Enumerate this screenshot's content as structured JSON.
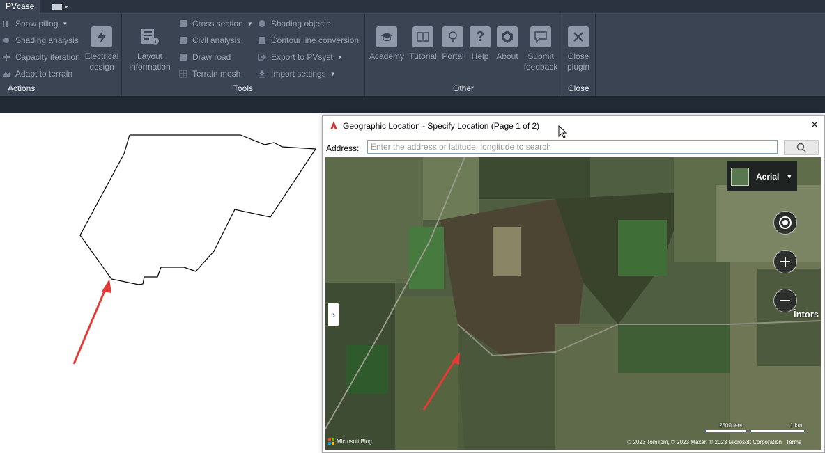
{
  "ribbon": {
    "active_tab": "PVcase",
    "actions": {
      "show_piling": "Show piling",
      "shading_analysis": "Shading analysis",
      "capacity_iteration": "Capacity iteration",
      "adapt_to_terrain": "Adapt to terrain",
      "electrical_design": "Electrical design",
      "label": "Actions"
    },
    "tools": {
      "layout_information": "Layout information",
      "cross_section": "Cross section",
      "civil_analysis": "Civil analysis",
      "draw_road": "Draw road",
      "terrain_mesh": "Terrain mesh",
      "shading_objects": "Shading objects",
      "contour_line_conversion": "Contour line conversion",
      "export_to_pvsyst": "Export to PVsyst",
      "import_settings": "Import settings",
      "label": "Tools"
    },
    "other": {
      "academy": "Academy",
      "tutorial": "Tutorial",
      "portal": "Portal",
      "help": "Help",
      "about": "About",
      "submit_feedback": "Submit feedback",
      "label": "Other"
    },
    "close": {
      "close_plugin": "Close plugin",
      "label": "Close"
    }
  },
  "dialog": {
    "title": "Geographic Location - Specify Location (Page 1 of 2)",
    "address_label": "Address:",
    "address_placeholder": "Enter the address or latitude, longitude to search",
    "address_value": ""
  },
  "map": {
    "map_type": "Aerial",
    "town_label": "Întors",
    "scale_feet": "2500 feet",
    "scale_km": "1 km",
    "attribution_brand": "Microsoft Bing",
    "copyright": "© 2023 TomTom, © 2023 Maxar, © 2023 Microsoft Corporation",
    "terms": "Terms"
  },
  "colors": {
    "ribbon_bg": "#3b4453",
    "tabbar_bg": "#2b3340",
    "annotation_arrow": "#e53935",
    "autocad_red": "#d32f2f"
  }
}
